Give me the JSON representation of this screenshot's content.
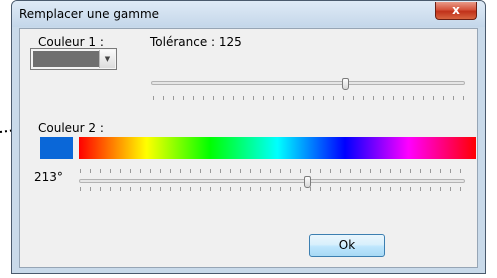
{
  "dialog": {
    "title": "Remplacer une gamme",
    "close_label": "x"
  },
  "colour1": {
    "label": "Couleur 1 :",
    "value_color": "#6f6f6f",
    "arrow_icon": "chevron-down-icon"
  },
  "tolerance": {
    "label": "Tolérance : 125",
    "value": 125
  },
  "colour2": {
    "label": "Couleur 2 :",
    "swatch_color": "#0a67d8"
  },
  "hue": {
    "label": "213°",
    "value_degrees": 213
  },
  "ok_button": {
    "label": "Ok"
  }
}
